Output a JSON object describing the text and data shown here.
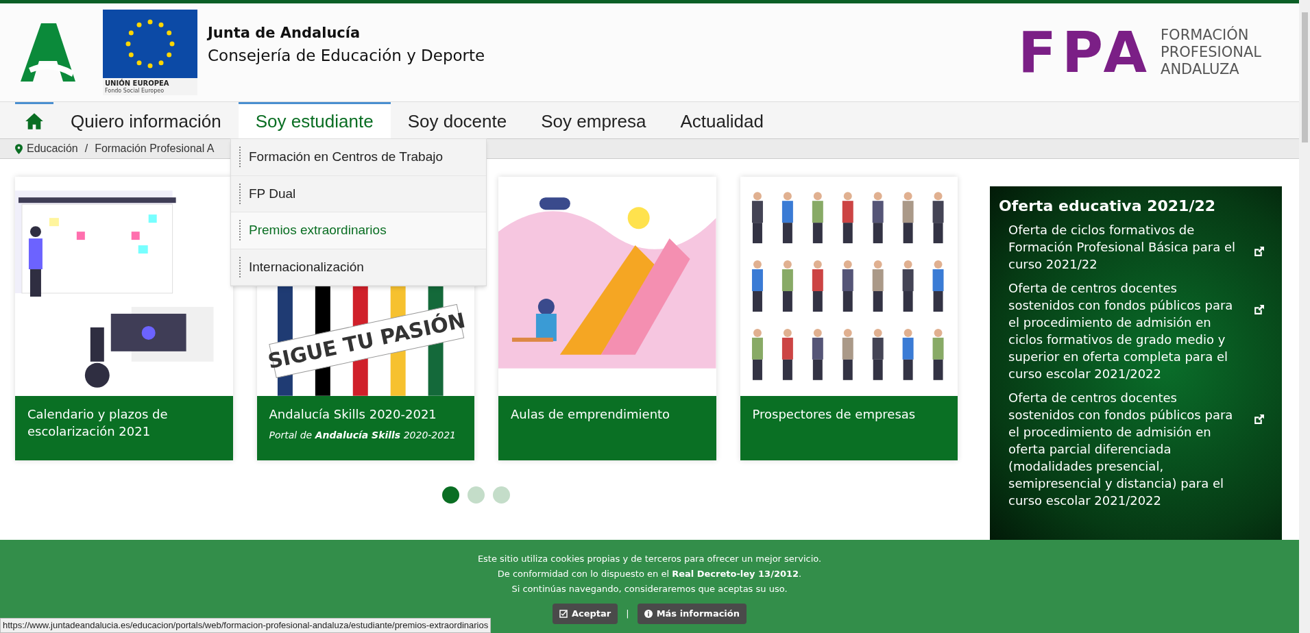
{
  "header": {
    "junta_logo_caption": "UNIÓN EUROPEA",
    "eu_fund": "Fondo Social Europeo",
    "org_name": "Junta de Andalucía",
    "department": "Consejería de Educación y Deporte",
    "fpa_mark": "FPA",
    "fpa_lines": [
      "FORMACIÓN",
      "PROFESIONAL",
      "ANDALUZA"
    ]
  },
  "nav": [
    {
      "kind": "home",
      "selected": true
    },
    {
      "kind": "link",
      "label": "Quiero información",
      "selected": false
    },
    {
      "kind": "link",
      "label": "Soy estudiante",
      "selected": true
    },
    {
      "kind": "link",
      "label": "Soy docente",
      "selected": false
    },
    {
      "kind": "link",
      "label": "Soy empresa",
      "selected": false
    },
    {
      "kind": "link",
      "label": "Actualidad",
      "selected": false
    }
  ],
  "dropdown": [
    {
      "label": "Formación en Centros de Trabajo",
      "selected": false
    },
    {
      "label": "FP Dual",
      "selected": false
    },
    {
      "label": "Premios extraordinarios",
      "selected": true
    },
    {
      "label": "Internacionalización",
      "selected": false
    }
  ],
  "breadcrumb": [
    "Educación",
    "/",
    "Formación Profesional A"
  ],
  "cards": [
    {
      "kind": "calendar",
      "title": "Calendario y plazos de escolarización 2021"
    },
    {
      "kind": "arrows",
      "title": "Andalucía Skills 2020-2021",
      "subtitle": "Portal de **Andalucía Skills** 2020-2021",
      "image_text": "SIGUE TU PASIÓN"
    },
    {
      "kind": "rocket",
      "title": "Aulas de emprendimiento"
    },
    {
      "kind": "people",
      "title": "Prospectores de empresas"
    }
  ],
  "carousel_dots": [
    {
      "selected": true
    },
    {
      "selected": false
    },
    {
      "selected": false
    }
  ],
  "side_panel": {
    "title": "Oferta educativa 2021/22",
    "items": [
      "Oferta de ciclos formativos de Formación Profesional Básica para el curso 2021/22",
      "Oferta de centros docentes sostenidos con fondos públicos para el procedimiento de admisión en ciclos formativos de grado medio y superior en oferta completa para el curso escolar 2021/2022",
      "Oferta de centros docentes sostenidos con fondos públicos para el procedimiento de admisión en oferta parcial diferenciada (modalidades presencial, semipresencial y distancia) para el curso escolar 2021/2022"
    ]
  },
  "cookie_bar": {
    "lines": [
      "Este sitio utiliza cookies propias y de terceros para ofrecer un mejor servicio.",
      "De conformidad con lo dispuesto en el **Real Decreto-ley 13/2012**.",
      "Si continúas navegando, consideraremos que aceptas su uso."
    ],
    "accept": "Aceptar",
    "separator": "|",
    "more": "Más información"
  },
  "status_url": "https://www.juntadeandalucia.es/educacion/portals/web/formacion-profesional-andaluza/estudiante/premios-extraordinarios"
}
